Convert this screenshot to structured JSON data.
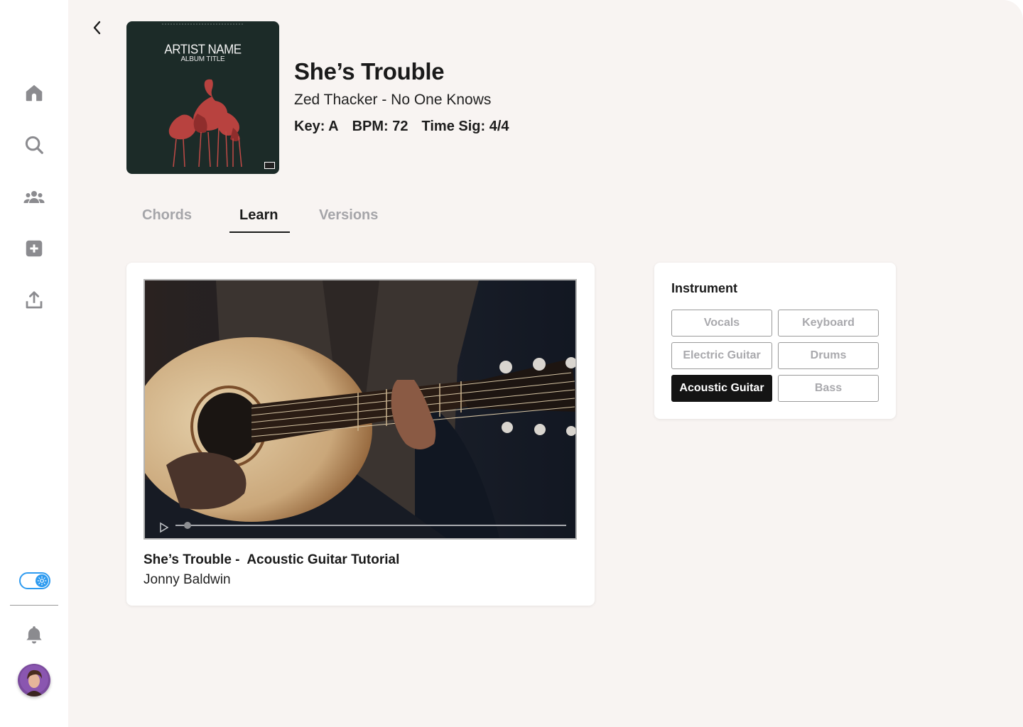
{
  "sidebar": {
    "nav": [
      {
        "name": "home-icon"
      },
      {
        "name": "search-icon"
      },
      {
        "name": "community-icon"
      },
      {
        "name": "add-icon"
      },
      {
        "name": "upload-icon"
      }
    ],
    "theme_toggle": "light-mode",
    "bottom": [
      {
        "name": "bell-icon"
      },
      {
        "name": "avatar"
      }
    ]
  },
  "album": {
    "artist": "ARTIST NAME",
    "title": "ALBUM TITLE"
  },
  "song": {
    "title": "She’s Trouble",
    "subtitle": "Zed Thacker - No One Knows",
    "key": "Key: A",
    "bpm": "BPM: 72",
    "time_sig": "Time Sig: 4/4"
  },
  "tabs": [
    {
      "label": "Chords",
      "active": false
    },
    {
      "label": "Learn",
      "active": true
    },
    {
      "label": "Versions",
      "active": false
    }
  ],
  "video": {
    "title": "She’s Trouble -  Acoustic Guitar Tutorial",
    "author": "Jonny Baldwin",
    "progress": 0.03
  },
  "instrument": {
    "heading": "Instrument",
    "options": [
      "Vocals",
      "Keyboard",
      "Electric Guitar",
      "Drums",
      "Acoustic Guitar",
      "Bass"
    ],
    "selected": "Acoustic Guitar"
  },
  "colors": {
    "accent": "#2e9bf0",
    "selected": "#141414",
    "background": "#f8f4f2",
    "icon": "#8b8b8f"
  }
}
